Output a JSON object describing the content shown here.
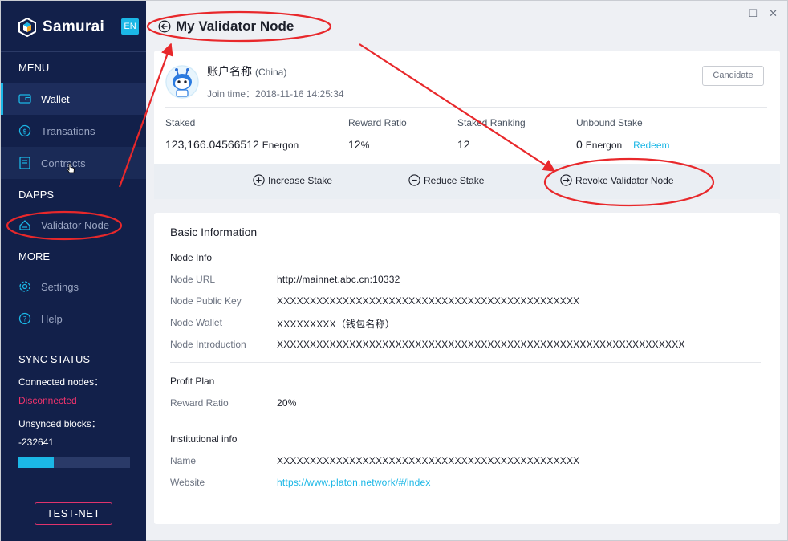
{
  "app": {
    "name": "Samurai",
    "language": "EN"
  },
  "window_controls": {
    "minimize": "—",
    "maximize": "☐",
    "close": "✕"
  },
  "sidebar": {
    "menu_title": "MENU",
    "menu_items": [
      {
        "label": "Wallet",
        "icon": "wallet-icon"
      },
      {
        "label": "Transations",
        "icon": "dollar-icon"
      },
      {
        "label": "Contracts",
        "icon": "contract-icon"
      }
    ],
    "dapps_title": "DAPPS",
    "dapps_items": [
      {
        "label": "Validator Node",
        "icon": "validator-icon"
      }
    ],
    "more_title": "MORE",
    "more_items": [
      {
        "label": "Settings",
        "icon": "gear-icon"
      },
      {
        "label": "Help",
        "icon": "help-icon"
      }
    ],
    "sync": {
      "title": "SYNC STATUS",
      "connected_label": "Connected nodes：",
      "connected_value": "Disconnected",
      "unsynced_label": "Unsynced blocks：",
      "unsynced_value": "-232641",
      "progress": 0.32
    },
    "network_button": "TEST-NET"
  },
  "page": {
    "title": "My Validator Node"
  },
  "account": {
    "name": "账户名称",
    "region": "(China)",
    "join_time": "Join time：2018-11-16 14:25:34",
    "status_button": "Candidate"
  },
  "stats": {
    "staked_label": "Staked",
    "staked_value": "123,166.04566512",
    "staked_unit": "Energon",
    "reward_label": "Reward Ratio",
    "reward_value": "12",
    "reward_unit": "%",
    "ranking_label": "Staked Ranking",
    "ranking_value": "12",
    "unbound_label": "Unbound Stake",
    "unbound_value": "0",
    "unbound_unit": "Energon",
    "redeem_label": "Redeem"
  },
  "actions": {
    "increase": "Increase Stake",
    "reduce": "Reduce Stake",
    "revoke": "Revoke Validator Node"
  },
  "basic_info": {
    "title": "Basic Information",
    "node_info_title": "Node Info",
    "node_url_label": "Node URL",
    "node_url_value": "http://mainnet.abc.cn:10332",
    "public_key_label": "Node Public Key",
    "public_key_value": "XXXXXXXXXXXXXXXXXXXXXXXXXXXXXXXXXXXXXXXXXXXXXX",
    "wallet_label": "Node Wallet",
    "wallet_value": "XXXXXXXXX（钱包名称）",
    "intro_label": "Node Introduction",
    "intro_value": "XXXXXXXXXXXXXXXXXXXXXXXXXXXXXXXXXXXXXXXXXXXXXXXXXXXXXXXXXXXXXX",
    "profit_title": "Profit Plan",
    "reward_label": "Reward Ratio",
    "reward_value": "20%",
    "institution_title": "Institutional info",
    "name_label": "Name",
    "name_value": "XXXXXXXXXXXXXXXXXXXXXXXXXXXXXXXXXXXXXXXXXXXXXX",
    "website_label": "Website",
    "website_value": "https://www.platon.network/#/index"
  },
  "colors": {
    "sidebar_bg": "#12204a",
    "accent": "#1bb7e6",
    "alert": "#f0336c",
    "annotation": "#e8282b"
  }
}
